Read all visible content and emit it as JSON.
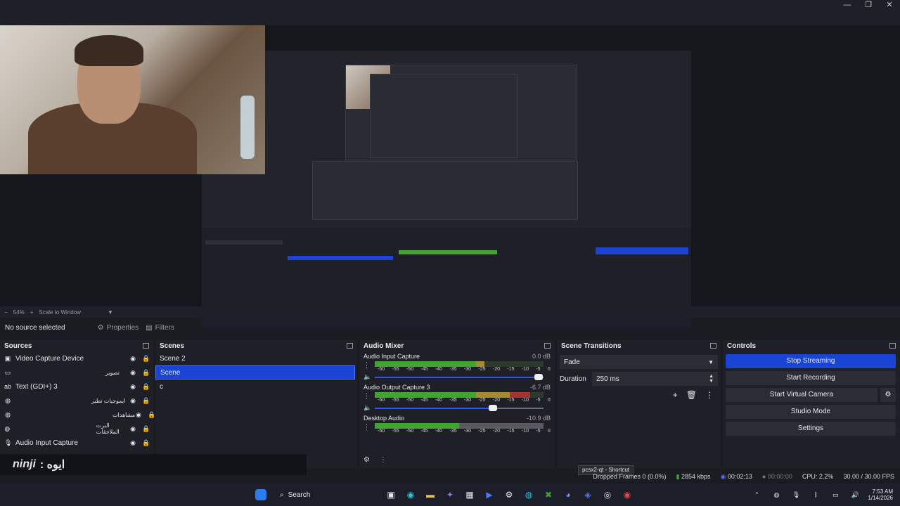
{
  "window": {
    "controls": [
      "—",
      "❐",
      "✕"
    ]
  },
  "zoom": {
    "value": "54%",
    "mode": "Scale to Window"
  },
  "sourcebar": {
    "status": "No source selected",
    "properties": "Properties",
    "filters": "Filters"
  },
  "sources": {
    "title": "Sources",
    "items": [
      {
        "label": "Video Capture Device",
        "icon": "camera-icon",
        "rtl": false
      },
      {
        "label": "تصوير",
        "icon": "window-capture-icon",
        "rtl": true
      },
      {
        "label": "Text (GDI+) 3",
        "icon": "text-icon",
        "rtl": false
      },
      {
        "label": "ايموجيات تطير",
        "icon": "browser-icon",
        "rtl": true
      },
      {
        "label": "مشاهدات",
        "icon": "browser-icon",
        "rtl": true
      },
      {
        "label": "البرت الملاحقات",
        "icon": "browser-icon",
        "rtl": true
      },
      {
        "label": "Audio Input Capture",
        "icon": "mic-icon",
        "rtl": false
      }
    ]
  },
  "scenes": {
    "title": "Scenes",
    "items": [
      {
        "label": "Scene 2",
        "selected": false
      },
      {
        "label": "Scene",
        "selected": true
      },
      {
        "label": "c",
        "selected": false
      }
    ]
  },
  "mixer": {
    "title": "Audio Mixer",
    "ticks": [
      "-60",
      "-55",
      "-50",
      "-45",
      "-40",
      "-35",
      "-30",
      "-25",
      "-20",
      "-15",
      "-10",
      "-5",
      "0"
    ],
    "channels": [
      {
        "name": "Audio Input Capture",
        "db": "0.0 dB",
        "level": 0.65,
        "volume": 0.97,
        "muted": false
      },
      {
        "name": "Audio Output Capture 3",
        "db": "-6.7 dB",
        "level": 0.92,
        "volume": 0.7,
        "muted": false
      },
      {
        "name": "Desktop Audio",
        "db": "-10.9 dB",
        "level": 0.5,
        "volume": null,
        "muted": false
      }
    ]
  },
  "transitions": {
    "title": "Scene Transitions",
    "type": "Fade",
    "duration_label": "Duration",
    "duration": "250 ms"
  },
  "controls": {
    "title": "Controls",
    "stop_streaming": "Stop Streaming",
    "start_recording": "Start Recording",
    "virtual_camera": "Start Virtual Camera",
    "studio_mode": "Studio Mode",
    "settings": "Settings"
  },
  "status": {
    "dropped": "Dropped Frames 0 (0.0%)",
    "kbps": "2854 kbps",
    "live_time": "00:02:13",
    "rec_time": "00:00:00",
    "cpu": "CPU: 2.2%",
    "fps": "30.00 / 30.00 FPS"
  },
  "tooltip": "pcsx2-qt - Shortcut",
  "overlay": {
    "brand": "ninji",
    "text": ": ايوه"
  },
  "taskbar": {
    "search": "Search",
    "time": "7:53 AM",
    "date": "1/14/2026"
  },
  "colors": {
    "accent": "#1a45d4",
    "meter_green": "#3fa52f",
    "meter_yellow": "#a58a2f",
    "meter_red": "#a5322f"
  }
}
